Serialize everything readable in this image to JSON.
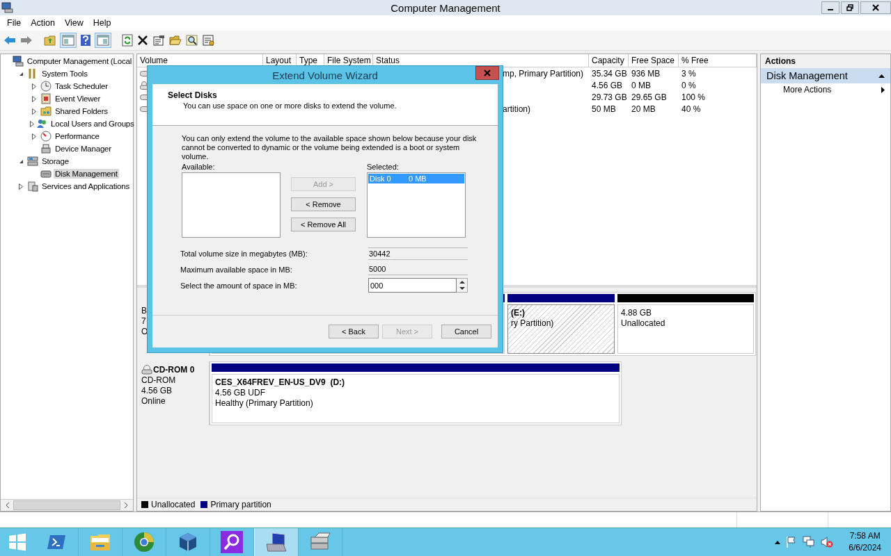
{
  "window": {
    "title": "Computer Management"
  },
  "menu": [
    "File",
    "Action",
    "View",
    "Help"
  ],
  "tree": [
    {
      "label": "Computer Management (Local",
      "selected": false,
      "children": [
        {
          "label": "System Tools",
          "expanded": true,
          "selected": false,
          "children": [
            {
              "label": "Task Scheduler",
              "expanded": false,
              "selected": false
            },
            {
              "label": "Event Viewer",
              "expanded": false,
              "selected": false
            },
            {
              "label": "Shared Folders",
              "expanded": false,
              "selected": false
            },
            {
              "label": "Local Users and Groups",
              "expanded": false,
              "selected": false
            },
            {
              "label": "Performance",
              "expanded": false,
              "selected": false
            },
            {
              "label": "Device Manager",
              "selected": false
            }
          ]
        },
        {
          "label": "Storage",
          "expanded": true,
          "selected": false,
          "children": [
            {
              "label": "Disk Management",
              "selected": true
            }
          ]
        },
        {
          "label": "Services and Applications",
          "expanded": false,
          "selected": false
        }
      ]
    }
  ],
  "volume_table": {
    "columns": [
      "Volume",
      "Layout",
      "Type",
      "File System",
      "Status",
      "Capacity",
      "Free Space",
      "% Free"
    ],
    "rows": [
      {
        "kind": "drive",
        "status": "mp, Primary Partition)",
        "capacity": "35.34 GB",
        "free_space": "936 MB",
        "percent_free": "3 %"
      },
      {
        "kind": "cd",
        "capacity": "4.56 GB",
        "free_space": "0 MB",
        "percent_free": "0 %"
      },
      {
        "kind": "drive",
        "capacity": "29.73 GB",
        "free_space": "29.65 GB",
        "percent_free": "100 %"
      },
      {
        "kind": "drive",
        "status": "artition)",
        "capacity": "50 MB",
        "free_space": "20 MB",
        "percent_free": "40 %"
      }
    ]
  },
  "disks": [
    {
      "label_lines": [
        "B",
        "7",
        "O"
      ],
      "partitions": [
        {
          "kind": "primary",
          "selected": false
        },
        {
          "kind": "primary",
          "selected": true,
          "title": "(E:)",
          "lines": [
            "ry Partition)"
          ]
        },
        {
          "kind": "unallocated",
          "selected": false,
          "lines": [
            "4.88 GB",
            "Unallocated"
          ]
        }
      ]
    },
    {
      "kind": "cdrom",
      "name": "CD-ROM 0",
      "label_lines": [
        "CD-ROM",
        "4.56 GB",
        "Online"
      ],
      "partitions": [
        {
          "kind": "primary",
          "selected": false,
          "title": "CES_X64FREV_EN-US_DV9  (D:)",
          "lines": [
            "4.56 GB UDF",
            "Healthy (Primary Partition)"
          ]
        }
      ]
    }
  ],
  "legend": [
    {
      "label": "Unallocated",
      "color": "#000000"
    },
    {
      "label": "Primary partition",
      "color": "#000080"
    }
  ],
  "actions": {
    "title": "Actions",
    "section": "Disk Management",
    "items": [
      "More Actions"
    ]
  },
  "dialog": {
    "title": "Extend Volume Wizard",
    "heading": "Select Disks",
    "subheading": "You can use space on one or more disks to extend the volume.",
    "note": "You can only extend the volume to the available space shown below because your disk cannot be converted to dynamic or the volume being extended is a boot or system volume.",
    "available_label": "Available:",
    "selected_label": "Selected:",
    "selected_disks": [
      {
        "name": "Disk 0",
        "size": "0 MB",
        "selected": true
      }
    ],
    "move_buttons": [
      {
        "label": "Add >",
        "disabled": true
      },
      {
        "label": "< Remove",
        "disabled": false
      },
      {
        "label": "< Remove All",
        "disabled": false
      }
    ],
    "fields": [
      {
        "kind": "readonly",
        "label": "Total volume size in megabytes (MB):",
        "value": "30442"
      },
      {
        "kind": "readonly",
        "label": "Maximum available space in MB:",
        "value": "5000"
      },
      {
        "kind": "spin",
        "label": "Select the amount of space in MB:",
        "value": "000"
      }
    ],
    "buttons": [
      {
        "label": "< Back",
        "disabled": false
      },
      {
        "label": "Next >",
        "disabled": true
      },
      {
        "label": "Cancel",
        "disabled": false
      }
    ]
  },
  "taskbar": {
    "apps": [
      {
        "kind": "shell",
        "selected": false
      },
      {
        "kind": "explorer",
        "selected": false
      },
      {
        "kind": "globe",
        "selected": false
      },
      {
        "kind": "cube",
        "selected": false
      },
      {
        "kind": "search",
        "selected": false
      },
      {
        "kind": "computer",
        "selected": true
      },
      {
        "kind": "server",
        "selected": false
      }
    ],
    "time": "7:58 AM",
    "date": "6/6/2024"
  }
}
